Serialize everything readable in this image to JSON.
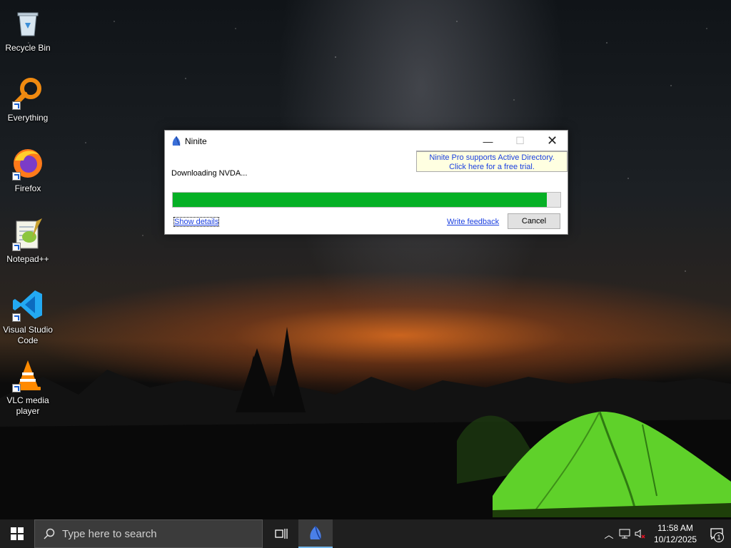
{
  "desktop": {
    "icons": [
      {
        "label": "Recycle Bin",
        "icon": "recycle-bin-icon"
      },
      {
        "label": "Everything",
        "icon": "everything-search-icon"
      },
      {
        "label": "Firefox",
        "icon": "firefox-icon"
      },
      {
        "label": "Notepad++",
        "icon": "notepad-plus-plus-icon"
      },
      {
        "label": "Visual Studio Code",
        "icon": "vscode-icon"
      },
      {
        "label": "VLC media player",
        "icon": "vlc-icon"
      }
    ]
  },
  "window": {
    "title": "Ninite",
    "minimize_glyph": "—",
    "maximize_glyph": "☐",
    "close_glyph": "✕",
    "promo_line1": "Ninite Pro supports Active Directory.",
    "promo_line2": "Click here for a free trial.",
    "status": "Downloading NVDA...",
    "progress_fraction": 0.965,
    "show_details": "Show details",
    "write_feedback": "Write feedback",
    "cancel": "Cancel",
    "colors": {
      "progress": "#06b025",
      "link": "#1a3fe0",
      "promo_bg": "#ffffe1"
    }
  },
  "taskbar": {
    "search_placeholder": "Type here to search",
    "time": "11:58 AM",
    "date": "10/12/2025",
    "notification_count": "1"
  }
}
